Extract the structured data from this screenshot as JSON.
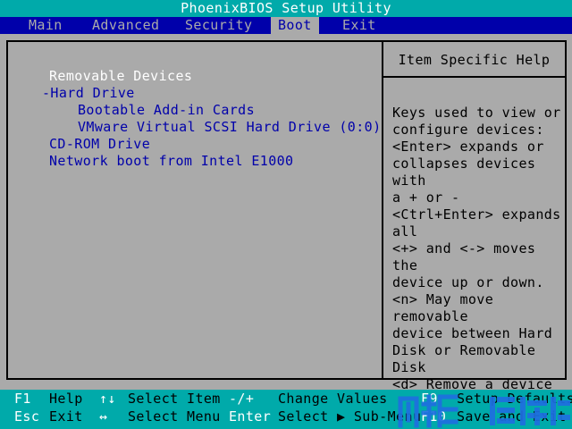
{
  "title": "PhoenixBIOS Setup Utility",
  "menu": [
    {
      "label": "Main"
    },
    {
      "label": "Advanced"
    },
    {
      "label": "Security"
    },
    {
      "label": "Boot"
    },
    {
      "label": "Exit"
    }
  ],
  "active_menu": "Boot",
  "boot_order": [
    {
      "label": "Removable Devices",
      "selected": true
    },
    {
      "label": "-Hard Drive",
      "selected": false
    },
    {
      "label": "Bootable Add-in Cards",
      "selected": false
    },
    {
      "label": "VMware Virtual SCSI Hard Drive (0:0)",
      "selected": false
    },
    {
      "label": "CD-ROM Drive",
      "selected": false
    },
    {
      "label": "Network boot from Intel E1000",
      "selected": false
    }
  ],
  "help": {
    "title": "Item Specific Help",
    "text": "Keys used to view or\nconfigure devices:\n<Enter> expands or\ncollapses devices with\na + or -\n<Ctrl+Enter> expands\nall\n<+> and <-> moves the\ndevice up or down.\n<n> May move removable\ndevice between Hard\nDisk or Removable Disk\n<d> Remove a device\nthat is not installed."
  },
  "status": {
    "f1_key": "F1",
    "f1_action": "Help",
    "updown_key": "↑↓",
    "updown_action": "Select Item",
    "change_key": "-/+",
    "change_action": "Change Values",
    "f9_key": "F9",
    "f9_action": "Setup Defaults",
    "esc_key": "Esc",
    "esc_action": "Exit",
    "leftright_key": "↔",
    "leftright_action": "Select Menu",
    "enter_key": "Enter",
    "enter_action": "Select ▶ Sub-Menu",
    "f10_key": "F10",
    "f10_action": "Save and Exit"
  },
  "colors": {
    "title_bg": "#00aaaa",
    "menu_bg": "#0000aa",
    "panel_bg": "#aaaaaa",
    "item_text": "#0000aa",
    "selected_text": "#ffffff"
  }
}
